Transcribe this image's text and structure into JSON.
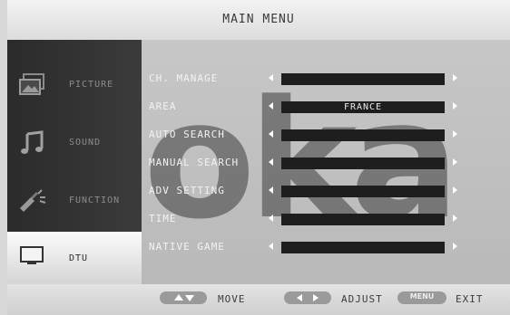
{
  "header": {
    "title": "MAIN MENU"
  },
  "watermark": "oka",
  "sidebar": {
    "items": [
      {
        "label": "PICTURE",
        "icon": "picture-icon",
        "active": false
      },
      {
        "label": "SOUND",
        "icon": "music-note-icon",
        "active": false
      },
      {
        "label": "FUNCTION",
        "icon": "function-tools-icon",
        "active": false
      },
      {
        "label": "DTU",
        "icon": "tv-monitor-icon",
        "active": true
      }
    ]
  },
  "settings": {
    "rows": [
      {
        "label": "CH. MANAGE",
        "value": ""
      },
      {
        "label": "AREA",
        "value": "FRANCE"
      },
      {
        "label": "AUTO SEARCH",
        "value": ""
      },
      {
        "label": "MANUAL SEARCH",
        "value": ""
      },
      {
        "label": "ADV SETTING",
        "value": ""
      },
      {
        "label": "TIME",
        "value": ""
      },
      {
        "label": "NATIVE GAME",
        "value": ""
      }
    ]
  },
  "help": {
    "move_label": "MOVE",
    "adjust_label": "ADJUST",
    "menu_key": "MENU",
    "exit_label": "EXIT"
  }
}
